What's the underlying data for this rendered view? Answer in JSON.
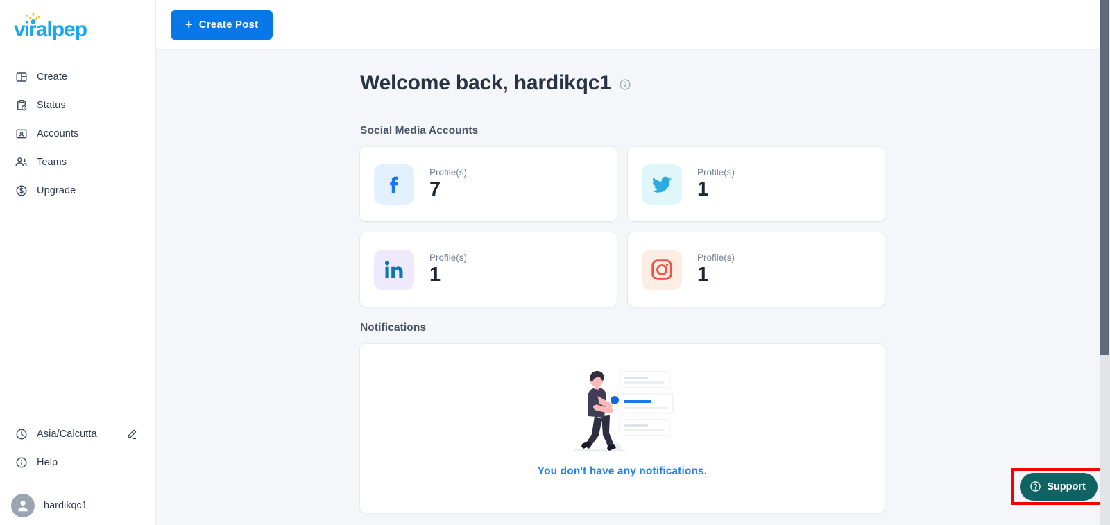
{
  "brand": {
    "name": "viralpep",
    "logo_icon": "sparkle-icon",
    "color": "#1ba7f0",
    "spark_color": "#ffc300"
  },
  "topbar": {
    "create_post_label": "Create Post",
    "create_post_icon": "plus-icon",
    "accent_color": "#0878e8"
  },
  "sidebar": {
    "items": [
      {
        "label": "Create",
        "icon": "layout-panels-icon"
      },
      {
        "label": "Status",
        "icon": "clipboard-clock-icon"
      },
      {
        "label": "Accounts",
        "icon": "contact-card-icon"
      },
      {
        "label": "Teams",
        "icon": "people-icon"
      },
      {
        "label": "Upgrade",
        "icon": "dollar-circle-icon"
      }
    ],
    "bottom_items": [
      {
        "label": "Asia/Calcutta",
        "icon": "clock-icon",
        "action_icon": "pencil-edit-icon"
      },
      {
        "label": "Help",
        "icon": "info-circle-icon"
      }
    ],
    "user": {
      "name": "hardikqc1",
      "avatar_icon": "user-avatar-icon"
    }
  },
  "main": {
    "welcome_title": "Welcome back, hardikqc1",
    "welcome_info_icon": "info-circle-icon",
    "social_section_label": "Social Media Accounts",
    "accounts": [
      {
        "network": "Facebook",
        "icon": "facebook-icon",
        "label": "Profile(s)",
        "count": "7",
        "icon_color": "#1977f3",
        "bg_color": "#e3f1fe"
      },
      {
        "network": "Twitter",
        "icon": "twitter-icon",
        "label": "Profile(s)",
        "count": "1",
        "icon_color": "#2daae1",
        "bg_color": "#e0f7fa"
      },
      {
        "network": "LinkedIn",
        "icon": "linkedin-icon",
        "label": "Profile(s)",
        "count": "1",
        "icon_color": "#0e76a8",
        "bg_color": "#eeeafb"
      },
      {
        "network": "Instagram",
        "icon": "instagram-icon",
        "label": "Profile(s)",
        "count": "1",
        "icon_color": "#f05245",
        "bg_color": "#fceee4"
      }
    ],
    "notifications_section_label": "Notifications",
    "notifications_empty_text": "You don't have any notifications.",
    "notifications_empty_color": "#2682ec",
    "notifications_illustration_icon": "person-walking-notifications-illustration"
  },
  "support": {
    "label": "Support",
    "icon": "question-circle-icon",
    "button_color": "#0f6363",
    "highlight_color": "#f40000"
  },
  "scrollbar": {
    "thumb_color": "#5f6b7d",
    "track_color": "#e2e4e6"
  }
}
